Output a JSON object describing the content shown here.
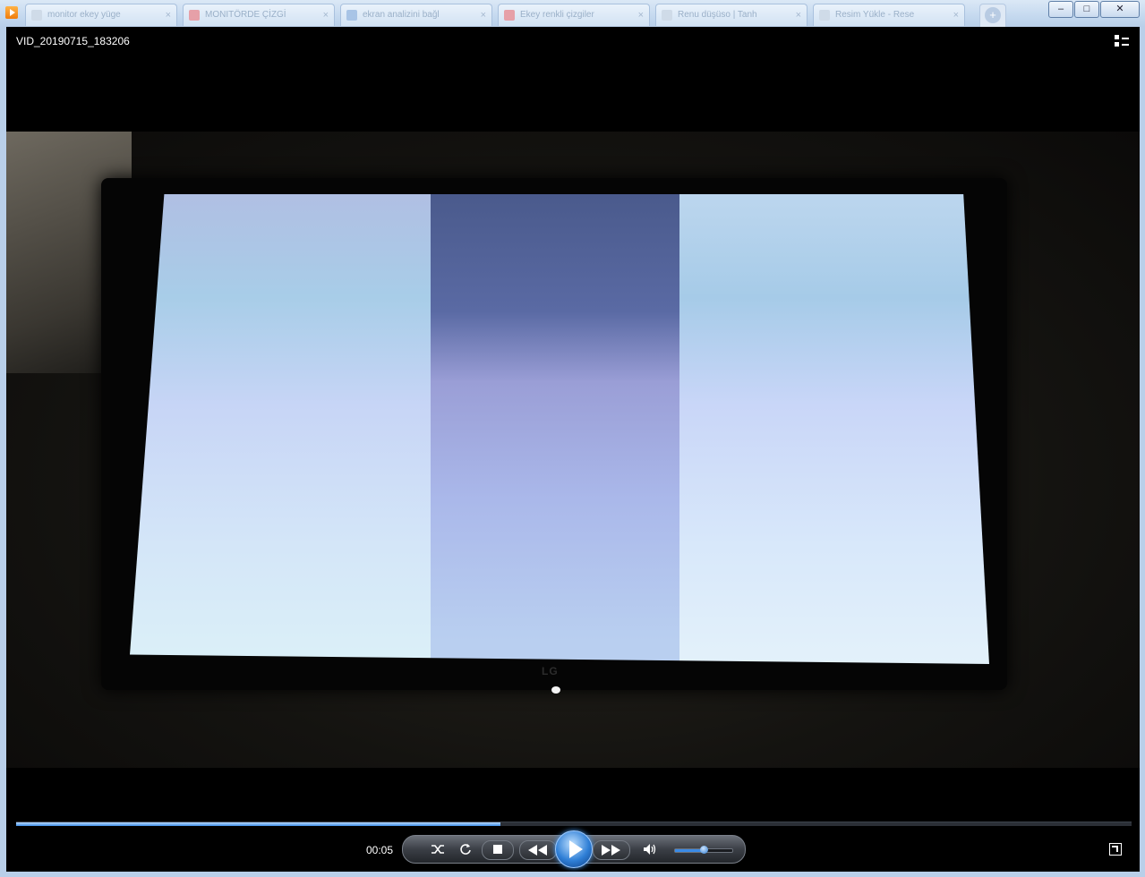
{
  "browser": {
    "tabs": [
      {
        "label": "monitor ekey yüge",
        "favicon": "play-favicon"
      },
      {
        "label": "MONITÖRDE ÇİZGİ",
        "favicon": "red-favicon"
      },
      {
        "label": "ekran analizini bağl",
        "favicon": "blue-favicon"
      },
      {
        "label": "Ekey renkli çizgiler",
        "favicon": "red-favicon"
      },
      {
        "label": "Renu düşüso | Tanh",
        "favicon": "blank-favicon"
      },
      {
        "label": "Resim Yükle - Rese",
        "favicon": "blank-favicon"
      }
    ],
    "tab_close_glyph": "×",
    "new_tab_glyph": "+",
    "window_controls": {
      "minimize": "–",
      "maximize": "□",
      "close": "✕"
    }
  },
  "player": {
    "video_title": "VID_20190715_183206",
    "elapsed_time": "00:05",
    "progress_fraction": 0.434,
    "volume_fraction": 0.5,
    "brand_text": "LG",
    "controls": {
      "shuffle": "shuffle-icon",
      "repeat": "repeat-icon",
      "stop": "stop-icon",
      "previous": "rewind-icon",
      "play": "play-icon",
      "next": "fast-forward-icon",
      "mute": "speaker-icon"
    },
    "accent_color": "#3f8fe8"
  }
}
